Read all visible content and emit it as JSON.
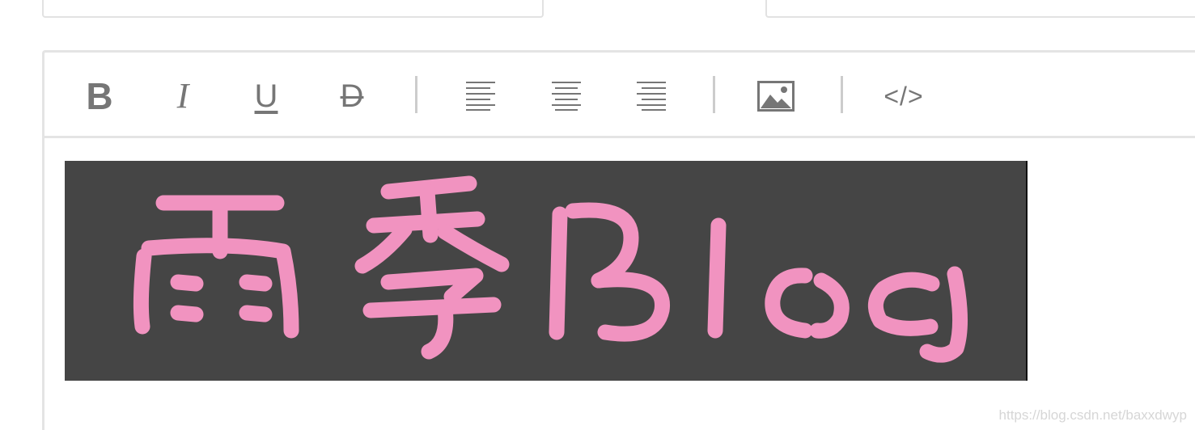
{
  "colors": {
    "icon": "#767676",
    "separator": "#cccccc",
    "border": "#e4e4e4",
    "banner_bg": "#454545",
    "banner_text": "#f193c0"
  },
  "toolbar": {
    "bold": {
      "label": "B",
      "icon": "bold-icon"
    },
    "italic": {
      "label": "I",
      "icon": "italic-icon"
    },
    "underline": {
      "label": "U",
      "icon": "underline-icon"
    },
    "strike": {
      "label": "D",
      "icon": "strikethrough-icon"
    },
    "align_left": {
      "icon": "align-left-icon"
    },
    "align_center": {
      "icon": "align-center-icon"
    },
    "align_right": {
      "icon": "align-right-icon"
    },
    "image": {
      "icon": "image-icon"
    },
    "code": {
      "label": "</>",
      "icon": "code-icon"
    }
  },
  "content": {
    "banner_text": "雨季Blog"
  },
  "watermark": "https://blog.csdn.net/baxxdwyp"
}
